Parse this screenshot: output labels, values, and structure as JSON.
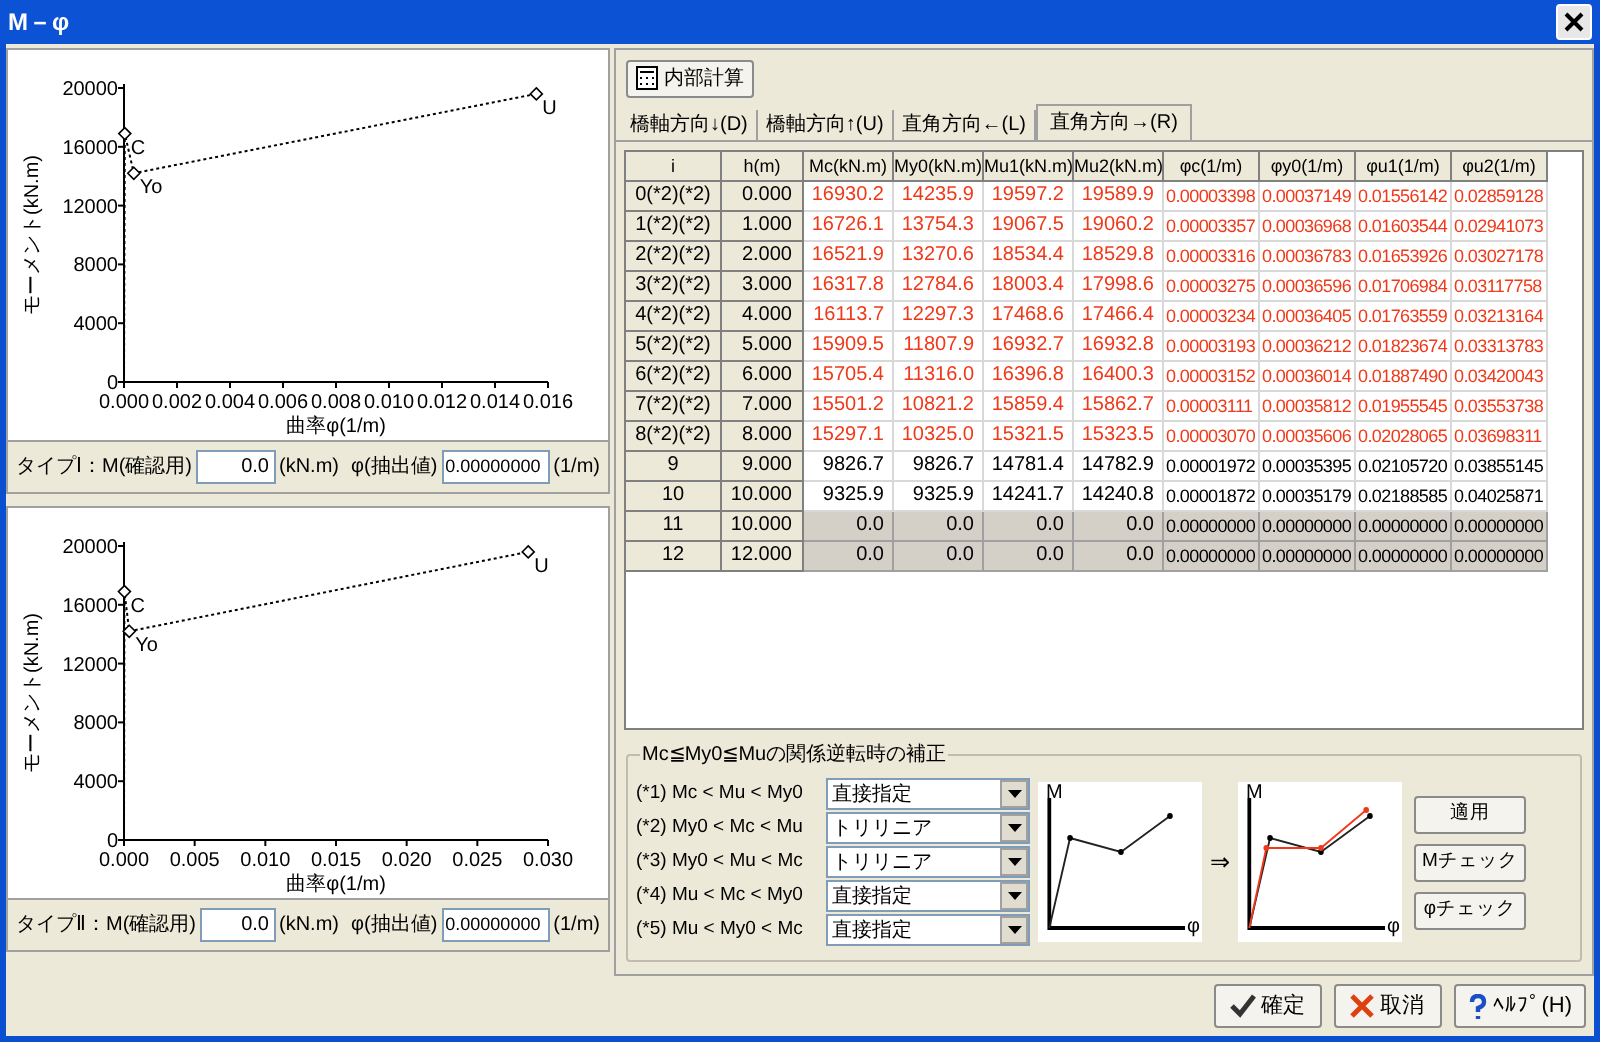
{
  "window": {
    "title": "M－φ"
  },
  "charts": [
    {
      "chart_data": {
        "type": "line",
        "xlabel": "曲率φ(1/m)",
        "ylabel": "モーメント(kN.m)",
        "x": [
          0,
          3e-05,
          0.00037,
          0.01556
        ],
        "series": [
          {
            "color": "#000000",
            "line_style": "dotted",
            "values": [
              0,
              16900,
              14200,
              19600
            ]
          }
        ],
        "xlim": [
          0,
          0.016
        ],
        "ylim": [
          0,
          20000
        ],
        "xticks": [
          {
            "value": 0,
            "label": "0.000"
          },
          {
            "value": 0.002,
            "label": "0.002"
          },
          {
            "value": 0.004,
            "label": "0.004"
          },
          {
            "value": 0.006,
            "label": "0.006"
          },
          {
            "value": 0.008,
            "label": "0.008"
          },
          {
            "value": 0.01,
            "label": "0.010"
          },
          {
            "value": 0.012,
            "label": "0.012"
          },
          {
            "value": 0.014,
            "label": "0.014"
          },
          {
            "value": 0.016,
            "label": "0.016"
          }
        ],
        "yticks": [
          0,
          4000,
          8000,
          12000,
          16000,
          20000
        ],
        "annotations": [
          {
            "x": 3e-05,
            "y": 16900,
            "text": "C"
          },
          {
            "x": 0.00037,
            "y": 14200,
            "text": "Yo"
          },
          {
            "x": 0.01556,
            "y": 19600,
            "text": "U"
          }
        ]
      },
      "input": {
        "label": "タイプⅠ：M(確認用)",
        "value": "0.0",
        "unit": "(kN.m)",
        "phi_label": "φ(抽出値)",
        "phi_value": "0.00000000",
        "phi_unit": "(1/m)"
      }
    },
    {
      "chart_data": {
        "type": "line",
        "xlabel": "曲率φ(1/m)",
        "ylabel": "モーメント(kN.m)",
        "x": [
          0,
          3e-05,
          0.00037,
          0.0286
        ],
        "series": [
          {
            "color": "#000000",
            "line_style": "dotted",
            "values": [
              0,
              16900,
              14200,
              19600
            ]
          }
        ],
        "xlim": [
          0,
          0.03
        ],
        "ylim": [
          0,
          20000
        ],
        "xticks": [
          {
            "value": 0,
            "label": "0.000"
          },
          {
            "value": 0.005,
            "label": "0.005"
          },
          {
            "value": 0.01,
            "label": "0.010"
          },
          {
            "value": 0.015,
            "label": "0.015"
          },
          {
            "value": 0.02,
            "label": "0.020"
          },
          {
            "value": 0.025,
            "label": "0.025"
          },
          {
            "value": 0.03,
            "label": "0.030"
          }
        ],
        "yticks": [
          0,
          4000,
          8000,
          12000,
          16000,
          20000
        ],
        "annotations": [
          {
            "x": 3e-05,
            "y": 16900,
            "text": "C"
          },
          {
            "x": 0.00037,
            "y": 14200,
            "text": "Yo"
          },
          {
            "x": 0.0286,
            "y": 19600,
            "text": "U"
          }
        ]
      },
      "input": {
        "label": "タイプⅡ：M(確認用)",
        "value": "0.0",
        "unit": "(kN.m)",
        "phi_label": "φ(抽出値)",
        "phi_value": "0.00000000",
        "phi_unit": "(1/m)"
      }
    }
  ],
  "calc_button": "内部計算",
  "tabs": [
    {
      "label": "橋軸方向↓(D)",
      "selected": false
    },
    {
      "label": "橋軸方向↑(U)",
      "selected": false
    },
    {
      "label": "直角方向←(L)",
      "selected": false
    },
    {
      "label": "直角方向→(R)",
      "selected": true
    }
  ],
  "table": {
    "columns": [
      "i",
      "h(m)",
      "Mc(kN.m)",
      "My0(kN.m)",
      "Mu1(kN.m)",
      "Mu2(kN.m)",
      "φc(1/m)",
      "φy0(1/m)",
      "φu1(1/m)",
      "φu2(1/m)"
    ],
    "rows": [
      {
        "cells": [
          "0(*2)(*2)",
          "0.000",
          "16930.2",
          "14235.9",
          "19597.2",
          "19589.9",
          "0.00003398",
          "0.00037149",
          "0.01556142",
          "0.02859128"
        ],
        "corrected": true,
        "disabled": false
      },
      {
        "cells": [
          "1(*2)(*2)",
          "1.000",
          "16726.1",
          "13754.3",
          "19067.5",
          "19060.2",
          "0.00003357",
          "0.00036968",
          "0.01603544",
          "0.02941073"
        ],
        "corrected": true,
        "disabled": false
      },
      {
        "cells": [
          "2(*2)(*2)",
          "2.000",
          "16521.9",
          "13270.6",
          "18534.4",
          "18529.8",
          "0.00003316",
          "0.00036783",
          "0.01653926",
          "0.03027178"
        ],
        "corrected": true,
        "disabled": false
      },
      {
        "cells": [
          "3(*2)(*2)",
          "3.000",
          "16317.8",
          "12784.6",
          "18003.4",
          "17998.6",
          "0.00003275",
          "0.00036596",
          "0.01706984",
          "0.03117758"
        ],
        "corrected": true,
        "disabled": false
      },
      {
        "cells": [
          "4(*2)(*2)",
          "4.000",
          "16113.7",
          "12297.3",
          "17468.6",
          "17466.4",
          "0.00003234",
          "0.00036405",
          "0.01763559",
          "0.03213164"
        ],
        "corrected": true,
        "disabled": false
      },
      {
        "cells": [
          "5(*2)(*2)",
          "5.000",
          "15909.5",
          "11807.9",
          "16932.7",
          "16932.8",
          "0.00003193",
          "0.00036212",
          "0.01823674",
          "0.03313783"
        ],
        "corrected": true,
        "disabled": false
      },
      {
        "cells": [
          "6(*2)(*2)",
          "6.000",
          "15705.4",
          "11316.0",
          "16396.8",
          "16400.3",
          "0.00003152",
          "0.00036014",
          "0.01887490",
          "0.03420043"
        ],
        "corrected": true,
        "disabled": false
      },
      {
        "cells": [
          "7(*2)(*2)",
          "7.000",
          "15501.2",
          "10821.2",
          "15859.4",
          "15862.7",
          "0.00003111",
          "0.00035812",
          "0.01955545",
          "0.03553738"
        ],
        "corrected": true,
        "disabled": false
      },
      {
        "cells": [
          "8(*2)(*2)",
          "8.000",
          "15297.1",
          "10325.0",
          "15321.5",
          "15323.5",
          "0.00003070",
          "0.00035606",
          "0.02028065",
          "0.03698311"
        ],
        "corrected": true,
        "disabled": false
      },
      {
        "cells": [
          "9",
          "9.000",
          "9826.7",
          "9826.7",
          "14781.4",
          "14782.9",
          "0.00001972",
          "0.00035395",
          "0.02105720",
          "0.03855145"
        ],
        "corrected": false,
        "disabled": false
      },
      {
        "cells": [
          "10",
          "10.000",
          "9325.9",
          "9325.9",
          "14241.7",
          "14240.8",
          "0.00001872",
          "0.00035179",
          "0.02188585",
          "0.04025871"
        ],
        "corrected": false,
        "disabled": false
      },
      {
        "cells": [
          "11",
          "10.000",
          "0.0",
          "0.0",
          "0.0",
          "0.0",
          "0.00000000",
          "0.00000000",
          "0.00000000",
          "0.00000000"
        ],
        "corrected": false,
        "disabled": true
      },
      {
        "cells": [
          "12",
          "12.000",
          "0.0",
          "0.0",
          "0.0",
          "0.0",
          "0.00000000",
          "0.00000000",
          "0.00000000",
          "0.00000000"
        ],
        "corrected": false,
        "disabled": true
      }
    ]
  },
  "correction": {
    "title": "Mc≦My0≦Muの関係逆転時の補正",
    "rows": [
      {
        "label": "(*1) Mc < Mu < My0",
        "value": "直接指定"
      },
      {
        "label": "(*2) My0 < Mc < Mu",
        "value": "トリリニア"
      },
      {
        "label": "(*3) My0 < Mu < Mc",
        "value": "トリリニア"
      },
      {
        "label": "(*4) Mu < Mc < My0",
        "value": "直接指定"
      },
      {
        "label": "(*5) Mu < My0 < Mc",
        "value": "直接指定"
      }
    ],
    "diagrams": [
      {
        "kind": "original",
        "y_label": "M",
        "x_label": "φ"
      },
      {
        "kind": "corrected",
        "y_label": "M",
        "x_label": "φ"
      }
    ],
    "arrow": "⇒",
    "buttons": [
      "適用",
      "Mチェック",
      "φチェック"
    ]
  },
  "footer_buttons": [
    {
      "label": "確定",
      "kind": "ok"
    },
    {
      "label": "取消",
      "kind": "cancel"
    },
    {
      "label": "ﾍﾙﾌﾟ(H)",
      "kind": "help"
    }
  ]
}
